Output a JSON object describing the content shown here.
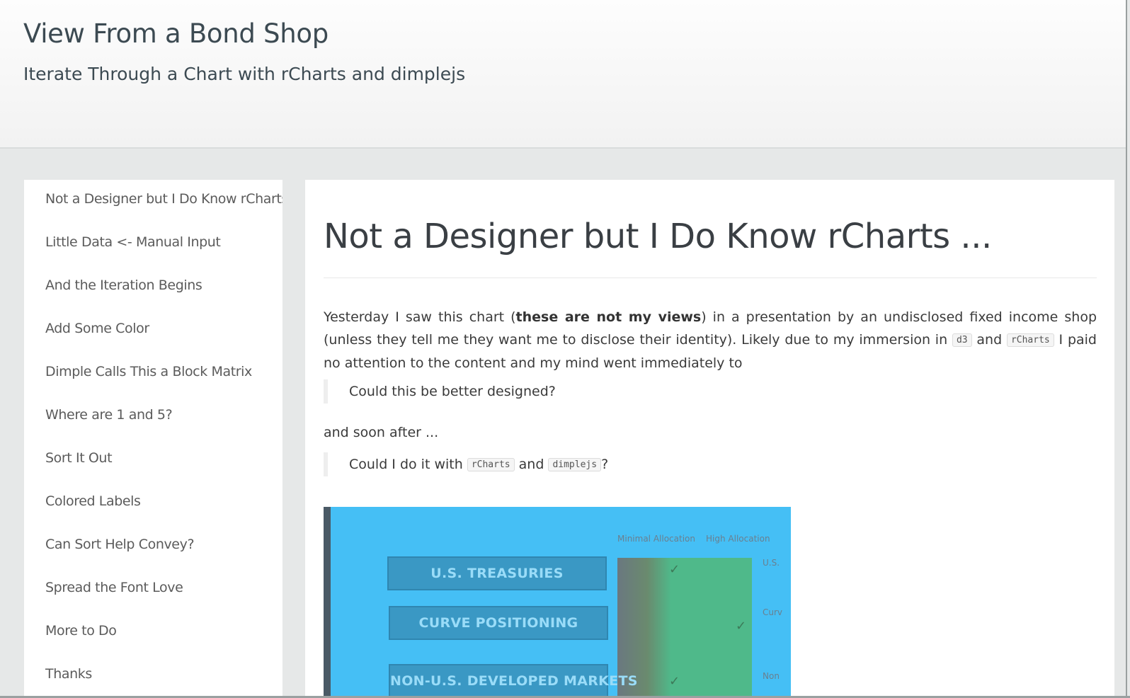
{
  "header": {
    "site_title": "View From a Bond Shop",
    "subtitle": "Iterate Through a Chart with rCharts and dimplejs"
  },
  "sidebar": {
    "items": [
      {
        "label": "Not a Designer but I Do Know rCharts"
      },
      {
        "label": "Little Data <- Manual Input"
      },
      {
        "label": "And the Iteration Begins"
      },
      {
        "label": "Add Some Color"
      },
      {
        "label": "Dimple Calls This a Block Matrix"
      },
      {
        "label": "Where are 1 and 5?"
      },
      {
        "label": "Sort It Out"
      },
      {
        "label": "Colored Labels"
      },
      {
        "label": "Can Sort Help Convey?"
      },
      {
        "label": "Spread the Font Love"
      },
      {
        "label": "More to Do"
      },
      {
        "label": "Thanks"
      }
    ]
  },
  "post": {
    "title": "Not a Designer but I Do Know rCharts ...",
    "para1": {
      "t1": "Yesterday I saw this chart (",
      "bold": "these are not my views",
      "t2": ") in a presentation by an undisclosed fixed income shop (unless they tell me they want me to disclose their identity). Likely due to my immersion in ",
      "code1": "d3",
      "t3": " and ",
      "code2": "rCharts",
      "t4": " I paid no attention to the content and my mind went immediately to"
    },
    "quote1": "Could this be better designed?",
    "para2": "and soon after ...",
    "quote2": {
      "t1": "Could I do it with ",
      "code1": "rCharts",
      "t2": " and ",
      "code2": "dimplejs",
      "t3": "?"
    }
  },
  "figure": {
    "rows": [
      "U.S. TREASURIES",
      "CURVE POSITIONING",
      "NON-U.S. DEVELOPED MARKETS"
    ],
    "col_headers": [
      "Minimal Allocation",
      "High Allocation"
    ],
    "side_labels": [
      "U.S.",
      "Curv",
      "Non"
    ],
    "check_glyph": "✓",
    "colors": {
      "background": "#45bff5",
      "bar": "#3a98c4",
      "green": "#4fb98a"
    }
  }
}
